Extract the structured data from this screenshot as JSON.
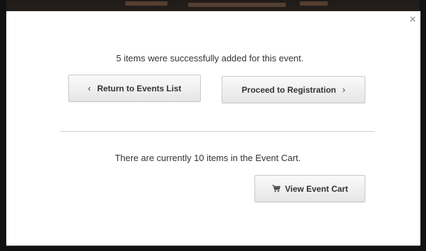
{
  "modal": {
    "close_label": "×",
    "success_message": "5 items were successfully added for this event.",
    "return_button": {
      "chevron": "‹",
      "label": "Return to Events List"
    },
    "proceed_button": {
      "label": "Proceed to Registration",
      "chevron": "›"
    },
    "cart_message": "There are currently 10 items in the Event Cart.",
    "view_cart_button": {
      "icon": "cart-icon",
      "label": "View Event Cart"
    }
  }
}
